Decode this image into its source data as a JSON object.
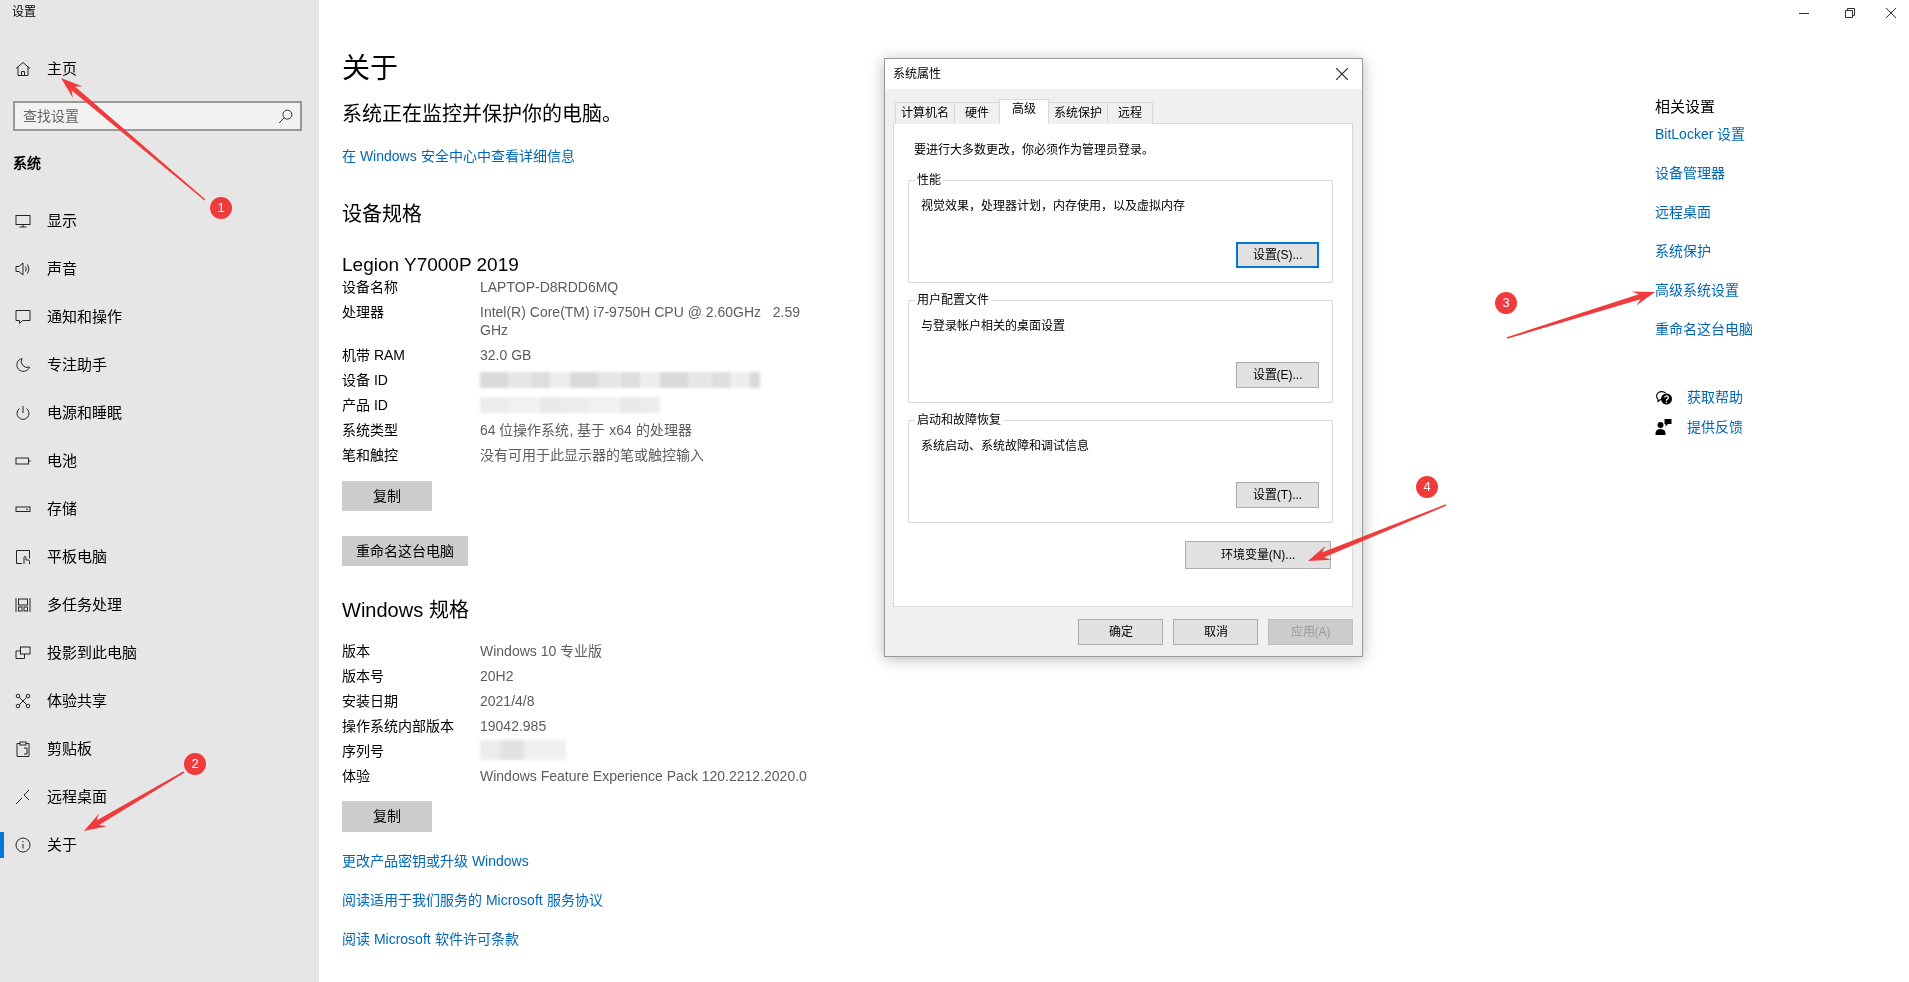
{
  "window": {
    "title": "设置"
  },
  "sidebar": {
    "home": "主页",
    "search": {
      "placeholder": "查找设置"
    },
    "section": "系统",
    "items": [
      {
        "label": "显示",
        "selected": false
      },
      {
        "label": "声音",
        "selected": false
      },
      {
        "label": "通知和操作",
        "selected": false
      },
      {
        "label": "专注助手",
        "selected": false
      },
      {
        "label": "电源和睡眠",
        "selected": false
      },
      {
        "label": "电池",
        "selected": false
      },
      {
        "label": "存储",
        "selected": false
      },
      {
        "label": "平板电脑",
        "selected": false
      },
      {
        "label": "多任务处理",
        "selected": false
      },
      {
        "label": "投影到此电脑",
        "selected": false
      },
      {
        "label": "体验共享",
        "selected": false
      },
      {
        "label": "剪贴板",
        "selected": false
      },
      {
        "label": "远程桌面",
        "selected": false
      },
      {
        "label": "关于",
        "selected": true
      }
    ]
  },
  "page": {
    "title": "关于",
    "status": "系统正在监控并保护你的电脑。",
    "security_link": "在 Windows 安全中心中查看详细信息",
    "device_specs": {
      "heading": "设备规格",
      "model": "Legion Y7000P 2019",
      "rows": [
        {
          "label": "设备名称",
          "kind": "text",
          "value": "LAPTOP-D8RDD6MQ"
        },
        {
          "label": "处理器",
          "kind": "text",
          "value": "Intel(R) Core(TM) i7-9750H CPU @ 2.60GHz   2.59 GHz"
        },
        {
          "label": "机带 RAM",
          "kind": "text",
          "value": "32.0 GB"
        },
        {
          "label": "设备 ID",
          "kind": "redacted"
        },
        {
          "label": "产品 ID",
          "kind": "redacted"
        },
        {
          "label": "系统类型",
          "kind": "text",
          "value": "64 位操作系统, 基于 x64 的处理器"
        },
        {
          "label": "笔和触控",
          "kind": "text",
          "value": "没有可用于此显示器的笔或触控输入"
        }
      ],
      "copy_button": "复制",
      "rename_button": "重命名这台电脑"
    },
    "windows_specs": {
      "heading": "Windows 规格",
      "rows": [
        {
          "label": "版本",
          "kind": "text",
          "value": "Windows 10 专业版"
        },
        {
          "label": "版本号",
          "kind": "text",
          "value": "20H2"
        },
        {
          "label": "安装日期",
          "kind": "text",
          "value": "2021/4/8"
        },
        {
          "label": "操作系统内部版本",
          "kind": "text",
          "value": "19042.985"
        },
        {
          "label": "序列号",
          "kind": "redacted"
        },
        {
          "label": "体验",
          "kind": "text",
          "value": "Windows Feature Experience Pack 120.2212.2020.0"
        }
      ],
      "copy_button": "复制"
    },
    "links": [
      "更改产品密钥或升级 Windows",
      "阅读适用于我们服务的 Microsoft 服务协议",
      "阅读 Microsoft 软件许可条款"
    ]
  },
  "related": {
    "heading": "相关设置",
    "links": [
      "BitLocker 设置",
      "设备管理器",
      "远程桌面",
      "系统保护",
      "高级系统设置",
      "重命名这台电脑"
    ]
  },
  "support": [
    "获取帮助",
    "提供反馈"
  ],
  "dialog": {
    "title": "系统属性",
    "tabs": [
      {
        "label": "计算机名",
        "selected": false
      },
      {
        "label": "硬件",
        "selected": false
      },
      {
        "label": "高级",
        "selected": true
      },
      {
        "label": "系统保护",
        "selected": false
      },
      {
        "label": "远程",
        "selected": false
      }
    ],
    "notice": "要进行大多数更改，你必须作为管理员登录。",
    "groups": [
      {
        "legend": "性能",
        "description": "视觉效果，处理器计划，内存使用，以及虚拟内存",
        "button": {
          "label": "设置(S)...",
          "focused": true
        }
      },
      {
        "legend": "用户配置文件",
        "description": "与登录帐户相关的桌面设置",
        "button": {
          "label": "设置(E)...",
          "focused": false
        }
      },
      {
        "legend": "启动和故障恢复",
        "description": "系统启动、系统故障和调试信息",
        "button": {
          "label": "设置(T)...",
          "focused": false
        }
      }
    ],
    "env_button": "环境变量(N)...",
    "buttons": [
      {
        "label": "确定",
        "disabled": false
      },
      {
        "label": "取消",
        "disabled": false
      },
      {
        "label": "应用(A)",
        "disabled": true
      }
    ]
  },
  "annotations": [
    {
      "number": "1"
    },
    {
      "number": "2"
    },
    {
      "number": "3"
    },
    {
      "number": "4"
    }
  ]
}
